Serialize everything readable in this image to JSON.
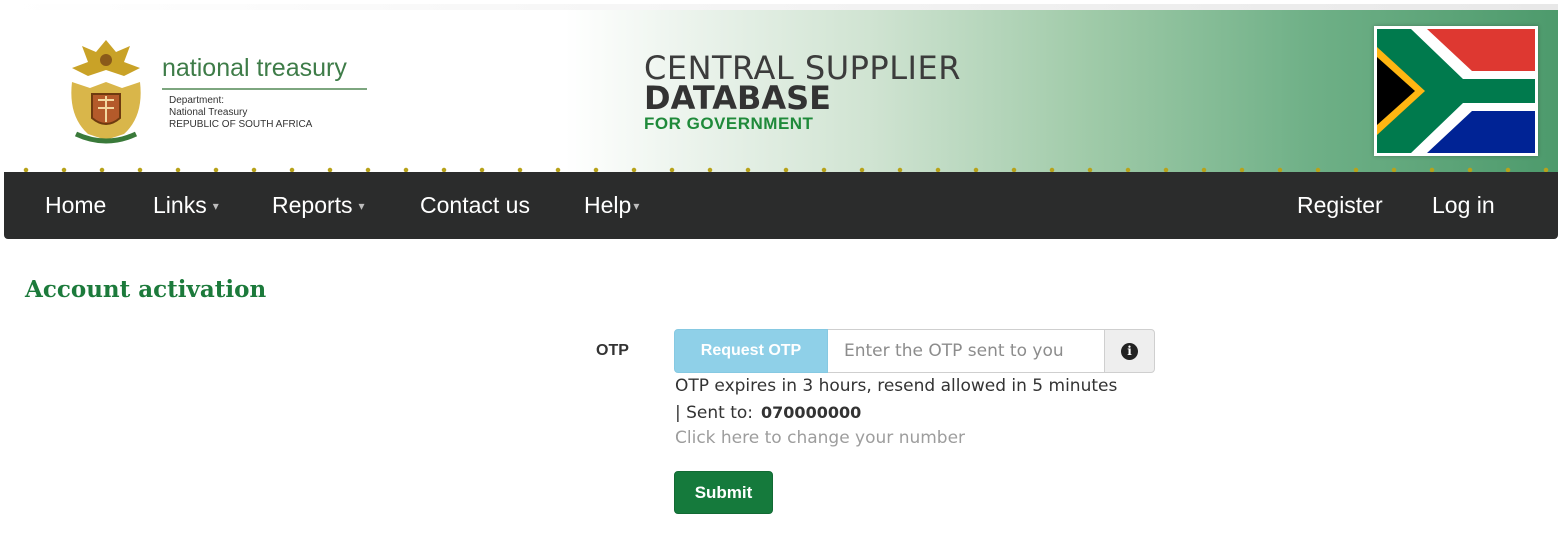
{
  "header": {
    "org_name": "national treasury",
    "dept_line1": "Department:",
    "dept_line2": "National Treasury",
    "dept_line3": "REPUBLIC OF SOUTH AFRICA",
    "app_title_line1": "CENTRAL SUPPLIER",
    "app_title_line2": "DATABASE",
    "app_title_line3": "FOR GOVERNMENT"
  },
  "nav": {
    "left": [
      {
        "label": "Home",
        "has_caret": false
      },
      {
        "label": "Links",
        "has_caret": true
      },
      {
        "label": "Reports",
        "has_caret": true
      },
      {
        "label": "Contact us",
        "has_caret": false
      },
      {
        "label": "Help",
        "has_caret": true
      }
    ],
    "right": [
      {
        "label": "Register"
      },
      {
        "label": "Log in"
      }
    ],
    "caret_icon": "caret-down-icon"
  },
  "page": {
    "title": "Account activation",
    "otp_label": "OTP",
    "request_otp_label": "Request OTP",
    "otp_placeholder": "Enter the OTP sent to you",
    "info_icon": "info-circle-icon",
    "expiry_text": "OTP expires in 3 hours, resend allowed in 5 minutes",
    "sent_to_label": "| Sent to:",
    "sent_to_number": "070000000",
    "change_number_link": "Click here to change your number",
    "submit_label": "Submit"
  },
  "colors": {
    "nav_bg": "#2b2c2c",
    "title_green": "#1c7a3b",
    "request_btn": "#8fd0e8",
    "submit_btn": "#157a3c"
  }
}
